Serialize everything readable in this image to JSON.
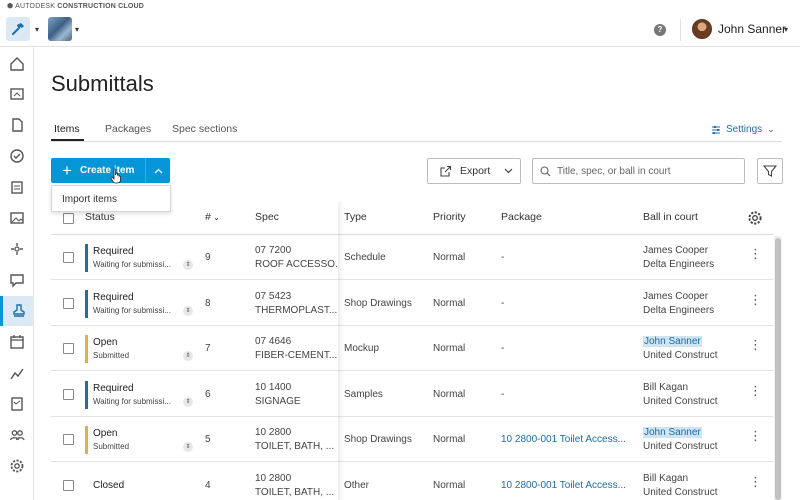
{
  "brand": {
    "prefix": "AUTODESK",
    "name": "CONSTRUCTION CLOUD"
  },
  "header": {
    "user_name": "John Sanner",
    "help_icon": "?"
  },
  "page": {
    "title": "Submittals"
  },
  "tabs": [
    {
      "label": "Items",
      "active": true
    },
    {
      "label": "Packages",
      "active": false
    },
    {
      "label": "Spec sections",
      "active": false
    }
  ],
  "settings_label": "Settings",
  "toolbar": {
    "create_label": "Create item",
    "dropdown_item": "Import items",
    "export_label": "Export",
    "search_placeholder": "Title, spec, or ball in court"
  },
  "table": {
    "columns": {
      "status": "Status",
      "number": "#",
      "spec": "Spec",
      "type": "Type",
      "priority": "Priority",
      "package": "Package",
      "ball_in_court": "Ball in court"
    },
    "rows": [
      {
        "status": "Required",
        "substatus": "Waiting for submissi...",
        "status_color": "#1a6fa8",
        "number": "9",
        "spec_code": "07 7200",
        "spec_name": "ROOF ACCESSO...",
        "type": "Schedule",
        "priority": "Normal",
        "package": "-",
        "package_link": false,
        "bic_name": "James Cooper",
        "bic_company": "Delta Engineers",
        "bic_highlight": false
      },
      {
        "status": "Required",
        "substatus": "Waiting for submissi...",
        "status_color": "#1a6fa8",
        "number": "8",
        "spec_code": "07 5423",
        "spec_name": "THERMOPLAST...",
        "type": "Shop Drawings",
        "priority": "Normal",
        "package": "-",
        "package_link": false,
        "bic_name": "James Cooper",
        "bic_company": "Delta Engineers",
        "bic_highlight": false
      },
      {
        "status": "Open",
        "substatus": "Submitted",
        "status_color": "#e0b13a",
        "number": "7",
        "spec_code": "07 4646",
        "spec_name": "FIBER-CEMENT...",
        "type": "Mockup",
        "priority": "Normal",
        "package": "-",
        "package_link": false,
        "bic_name": "John Sanner",
        "bic_company": "United Construct",
        "bic_highlight": true
      },
      {
        "status": "Required",
        "substatus": "Waiting for submissi...",
        "status_color": "#1a6fa8",
        "number": "6",
        "spec_code": "10 1400",
        "spec_name": "SIGNAGE",
        "type": "Samples",
        "priority": "Normal",
        "package": "-",
        "package_link": false,
        "bic_name": "Bill Kagan",
        "bic_company": "United Construct",
        "bic_highlight": false
      },
      {
        "status": "Open",
        "substatus": "Submitted",
        "status_color": "#e0b13a",
        "number": "5",
        "spec_code": "10 2800",
        "spec_name": "TOILET, BATH, ...",
        "type": "Shop Drawings",
        "priority": "Normal",
        "package": "10 2800-001 Toilet Access...",
        "package_link": true,
        "bic_name": "John Sanner",
        "bic_company": "United Construct",
        "bic_highlight": true
      },
      {
        "status": "Closed",
        "substatus": "",
        "status_color": "",
        "number": "4",
        "spec_code": "10 2800",
        "spec_name": "TOILET, BATH, ...",
        "type": "Other",
        "priority": "Normal",
        "package": "10 2800-001 Toilet Access...",
        "package_link": true,
        "bic_name": "Bill Kagan",
        "bic_company": "United Construct",
        "bic_highlight": false
      }
    ]
  },
  "colors": {
    "accent": "#0696d7",
    "link": "#1a6fa8",
    "required": "#1a6fa8",
    "open": "#e0b13a"
  },
  "rail_icons": [
    "home-icon",
    "sheets-icon",
    "files-icon",
    "issues-icon",
    "forms-icon",
    "photos-icon",
    "assets-icon",
    "rfis-icon",
    "submittals-icon",
    "schedule-icon",
    "reports-icon",
    "meetings-icon",
    "members-icon",
    "settings-icon"
  ]
}
